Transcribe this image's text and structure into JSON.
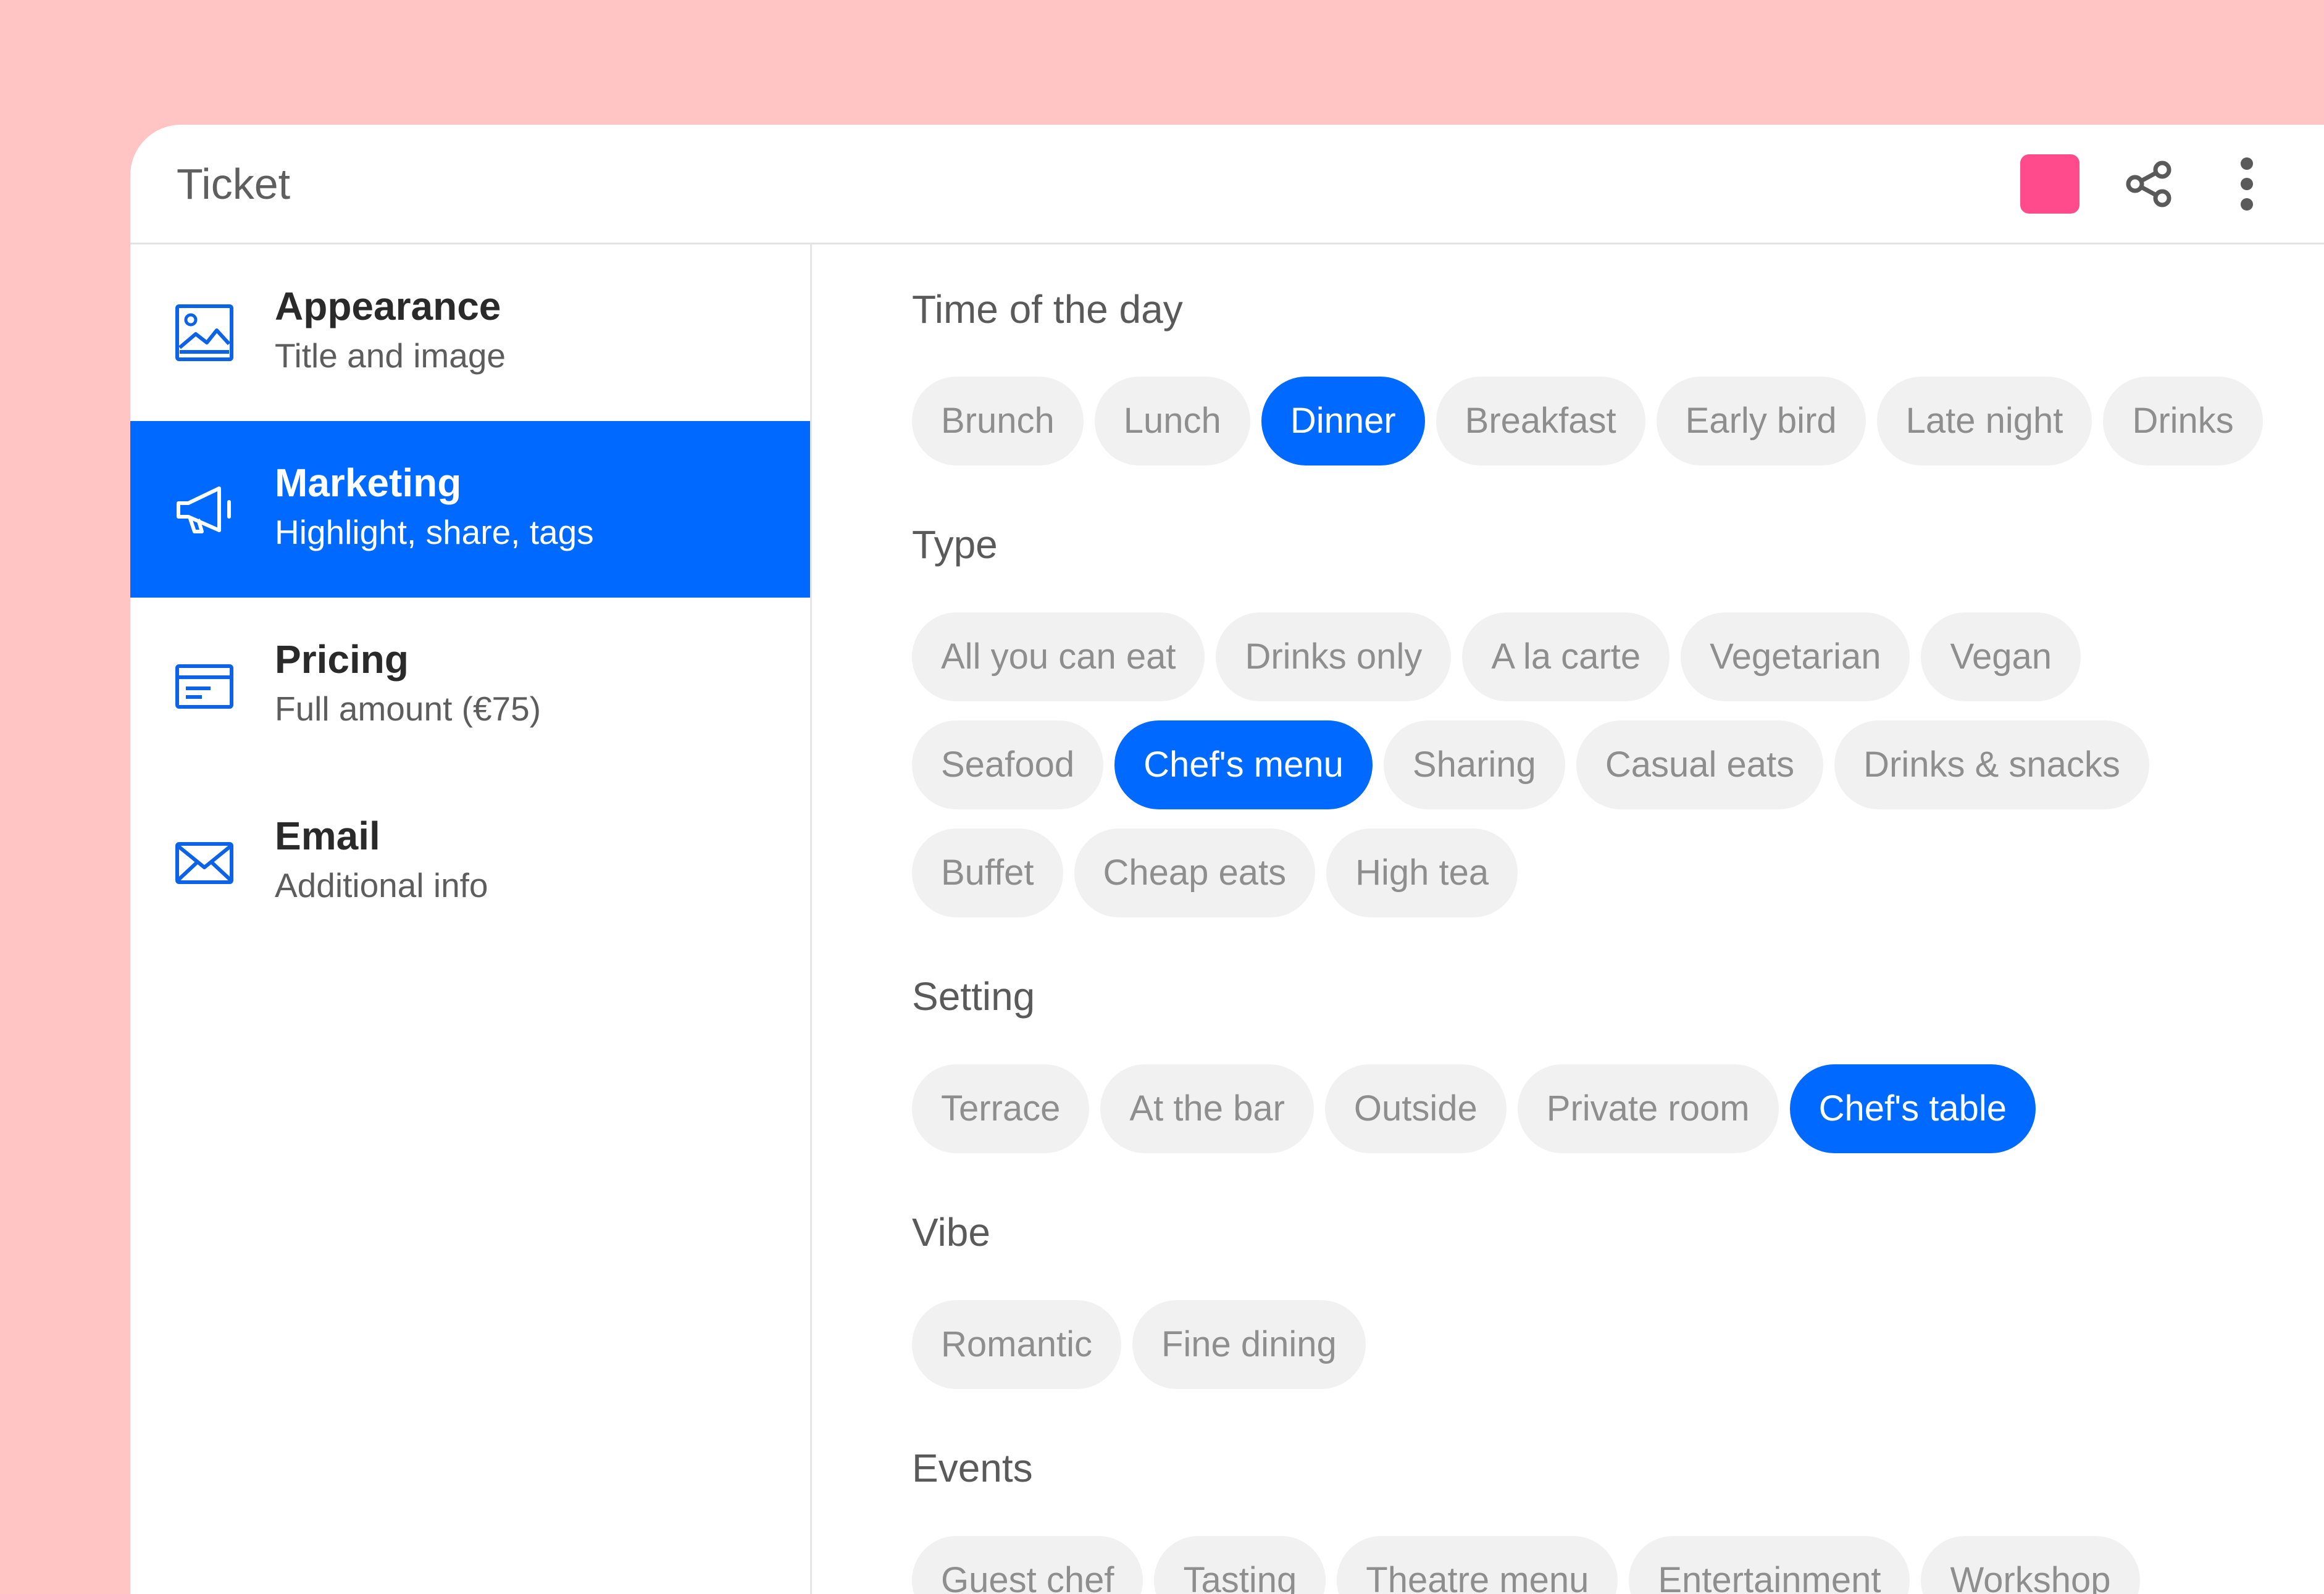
{
  "header": {
    "title": "Ticket",
    "swatch_color": "#ff4b8b",
    "share_icon": "share-icon",
    "more_icon": "more-vertical-icon"
  },
  "sidebar": {
    "items": [
      {
        "title": "Appearance",
        "subtitle": "Title and image",
        "icon": "image-icon",
        "active": false
      },
      {
        "title": "Marketing",
        "subtitle": "Highlight, share, tags",
        "icon": "megaphone-icon",
        "active": true
      },
      {
        "title": "Pricing",
        "subtitle": "Full amount (€75)",
        "icon": "credit-card-icon",
        "active": false
      },
      {
        "title": "Email",
        "subtitle": "Additional info",
        "icon": "envelope-icon",
        "active": false
      }
    ]
  },
  "sections": [
    {
      "label": "Time of the day",
      "rows": [
        [
          {
            "label": "Brunch",
            "selected": false
          },
          {
            "label": "Lunch",
            "selected": false
          },
          {
            "label": "Dinner",
            "selected": true
          },
          {
            "label": "Breakfast",
            "selected": false
          },
          {
            "label": "Early bird",
            "selected": false
          },
          {
            "label": "Late night",
            "selected": false
          },
          {
            "label": "Drinks",
            "selected": false
          }
        ]
      ]
    },
    {
      "label": "Type",
      "rows": [
        [
          {
            "label": "All you can eat",
            "selected": false
          },
          {
            "label": "Drinks only",
            "selected": false
          },
          {
            "label": "A la carte",
            "selected": false
          },
          {
            "label": "Vegetarian",
            "selected": false
          },
          {
            "label": "Vegan",
            "selected": false
          }
        ],
        [
          {
            "label": "Seafood",
            "selected": false
          },
          {
            "label": "Chef's menu",
            "selected": true
          },
          {
            "label": "Sharing",
            "selected": false
          },
          {
            "label": "Casual eats",
            "selected": false
          },
          {
            "label": "Drinks & snacks",
            "selected": false
          }
        ],
        [
          {
            "label": "Buffet",
            "selected": false
          },
          {
            "label": "Cheap eats",
            "selected": false
          },
          {
            "label": "High tea",
            "selected": false
          }
        ]
      ]
    },
    {
      "label": "Setting",
      "rows": [
        [
          {
            "label": "Terrace",
            "selected": false
          },
          {
            "label": "At the bar",
            "selected": false
          },
          {
            "label": "Outside",
            "selected": false
          },
          {
            "label": "Private room",
            "selected": false
          },
          {
            "label": "Chef's table",
            "selected": true
          }
        ]
      ]
    },
    {
      "label": "Vibe",
      "rows": [
        [
          {
            "label": "Romantic",
            "selected": false
          },
          {
            "label": "Fine dining",
            "selected": false
          }
        ]
      ]
    },
    {
      "label": "Events",
      "rows": [
        [
          {
            "label": "Guest chef",
            "selected": false
          },
          {
            "label": "Tasting",
            "selected": false
          },
          {
            "label": "Theatre menu",
            "selected": false
          },
          {
            "label": "Entertainment",
            "selected": false
          },
          {
            "label": "Workshop",
            "selected": false
          }
        ]
      ]
    }
  ],
  "colors": {
    "background": "#ffc4c3",
    "accent": "#0069ff",
    "chip_bg": "#f1f1f1",
    "chip_text": "#8e8e8e"
  }
}
